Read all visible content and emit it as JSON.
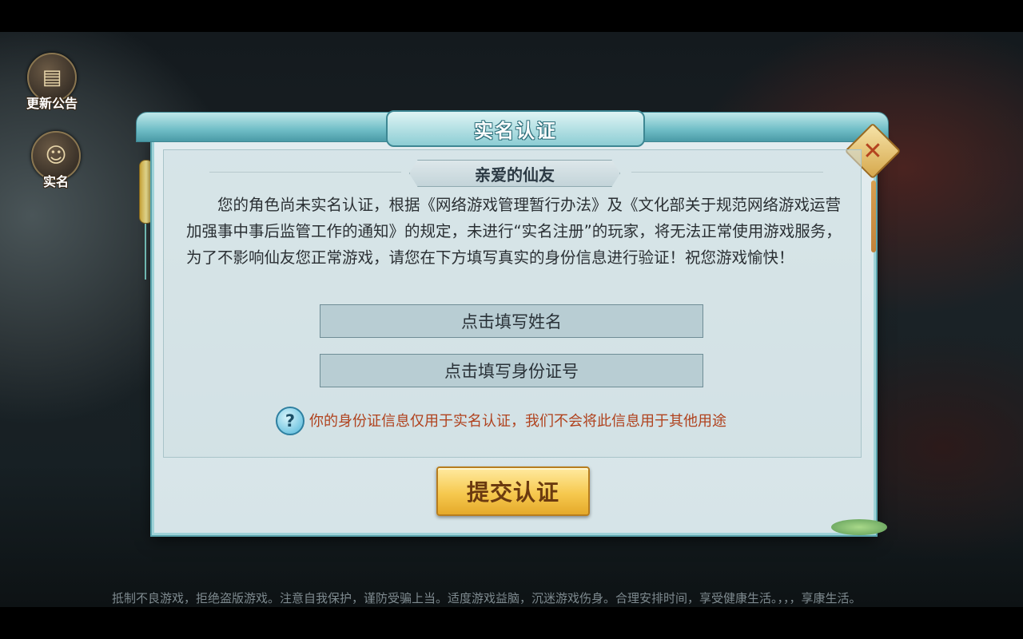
{
  "side_buttons": {
    "announcement_label": "更新公告",
    "realname_label": "实名"
  },
  "dialog": {
    "title": "实名认证",
    "close_symbol": "✕",
    "greeting": "亲爱的仙友",
    "notice": "您的角色尚未实名认证，根据《网络游戏管理暂行办法》及《文化部关于规范网络游戏运营加强事中事后监管工作的通知》的规定，未进行“实名注册”的玩家，将无法正常使用游戏服务，为了不影响仙友您正常游戏，请您在下方填写真实的身份信息进行验证！祝您游戏愉快！",
    "name_field": "点击填写姓名",
    "id_field": "点击填写身份证号",
    "help_symbol": "?",
    "privacy_note": "你的身份证信息仅用于实名认证，我们不会将此信息用于其他用途",
    "submit_label": "提交认证"
  },
  "footer": {
    "health_notice": "抵制不良游戏，拒绝盗版游戏。注意自我保护，谨防受骗上当。适度游戏益脑，沉迷游戏伤身。合理安排时间，享受健康生活。，，，享康生活。"
  },
  "icons": {
    "announcement": "announcement-icon",
    "realname": "realname-icon",
    "close": "close-icon",
    "help": "question-mark-icon"
  },
  "colors": {
    "title_teal": "#6fbdc6",
    "submit_gold": "#f6c94f",
    "privacy_red": "#b0421e",
    "dialog_bg": "#dbe7ea"
  }
}
